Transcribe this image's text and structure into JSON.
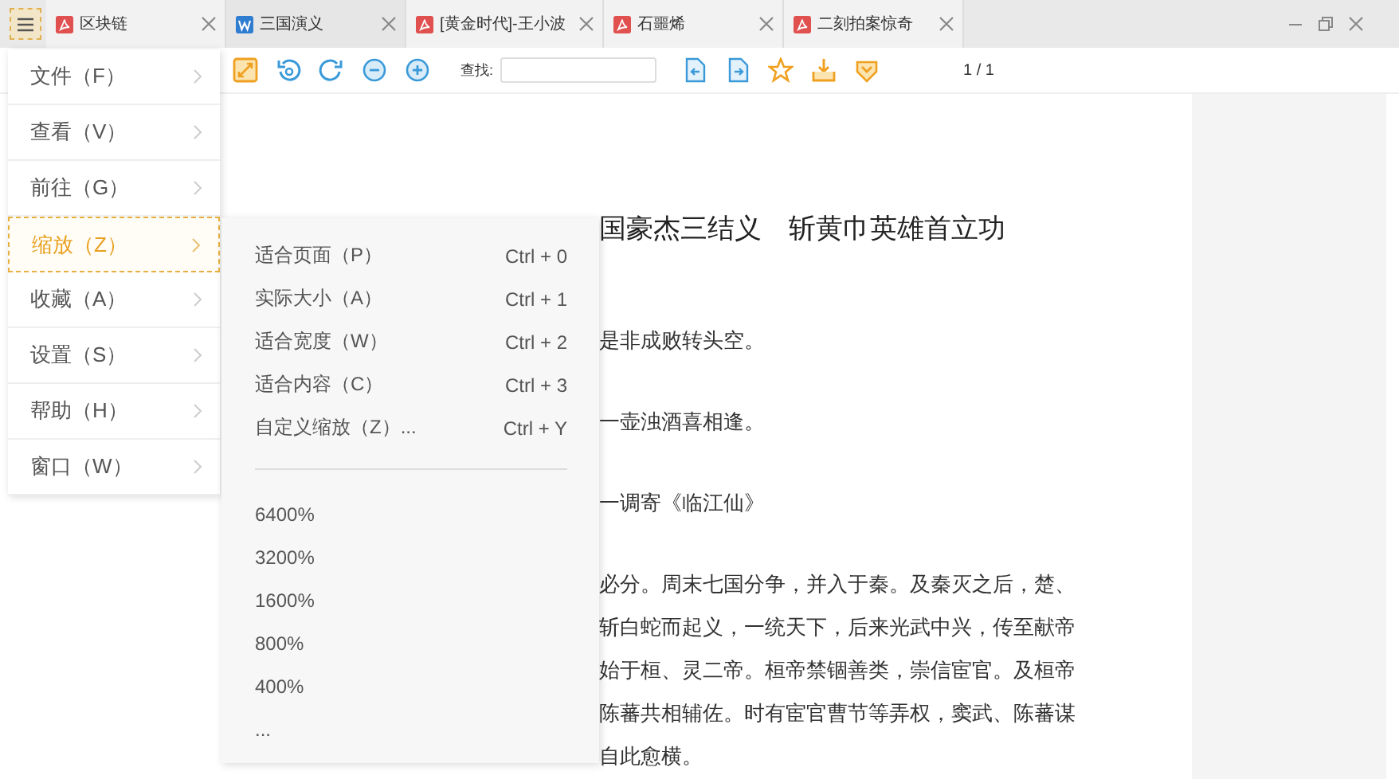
{
  "tabs": [
    {
      "label": "区块链",
      "kind": "pdf",
      "selected": false
    },
    {
      "label": "三国演义",
      "kind": "word",
      "selected": true
    },
    {
      "label": "[黄金时代]-王小波",
      "kind": "pdf",
      "selected": false
    },
    {
      "label": "石噩烯",
      "kind": "pdf",
      "selected": false
    },
    {
      "label": "二刻拍案惊奇",
      "kind": "pdf",
      "selected": false
    }
  ],
  "toolbar": {
    "search_label": "查找:",
    "page_indicator": "1 / 1"
  },
  "menu": {
    "items": [
      {
        "label": "文件（F）",
        "selected": false
      },
      {
        "label": "查看（V）",
        "selected": false
      },
      {
        "label": "前往（G）",
        "selected": false
      },
      {
        "label": "缩放（Z）",
        "selected": true
      },
      {
        "label": "收藏（A）",
        "selected": false
      },
      {
        "label": "设置（S）",
        "selected": false
      },
      {
        "label": "帮助（H）",
        "selected": false
      },
      {
        "label": "窗口（W）",
        "selected": false
      }
    ],
    "submenu": {
      "commands": [
        {
          "label": "适合页面（P）",
          "shortcut": "Ctrl + 0"
        },
        {
          "label": "实际大小（A）",
          "shortcut": "Ctrl + 1"
        },
        {
          "label": "适合宽度（W）",
          "shortcut": "Ctrl + 2"
        },
        {
          "label": "适合内容（C）",
          "shortcut": "Ctrl + 3"
        },
        {
          "label": "自定义缩放（Z）...",
          "shortcut": "Ctrl + Y"
        }
      ],
      "zoom_levels": [
        "6400%",
        "3200%",
        "1600%",
        "800%",
        "400%",
        "..."
      ]
    }
  },
  "document": {
    "title": "国豪杰三结义　斩黄巾英雄首立功",
    "verse": [
      "是非成败转头空。",
      "一壶浊酒喜相逢。",
      "一调寄《临江仙》"
    ],
    "paragraph": [
      "必分。周末七国分争，并入于秦。及秦灭之后，楚、",
      "斩白蛇而起义，一统天下，后来光武中兴，传至献帝",
      "始于桓、灵二帝。桓帝禁锢善类，崇信宦官。及桓帝",
      "陈蕃共相辅佐。时有宦官曹节等弄权，窦武、陈蕃谋",
      "自此愈横。"
    ]
  }
}
